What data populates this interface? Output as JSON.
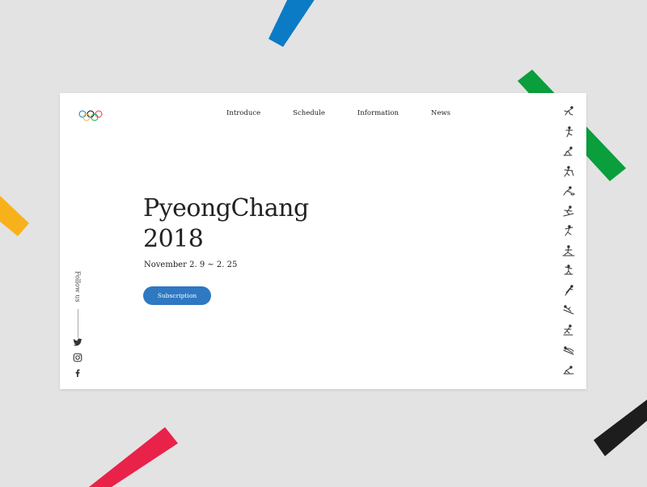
{
  "decorations": [
    {
      "name": "blue-stripe",
      "color": "#0b7bc6"
    },
    {
      "name": "green-stripe",
      "color": "#0a9e3d"
    },
    {
      "name": "yellow-stripe",
      "color": "#f7b21b"
    },
    {
      "name": "red-stripe",
      "color": "#e9224a"
    },
    {
      "name": "black-stripe",
      "color": "#1d1d1d"
    }
  ],
  "logo": {
    "icon": "olympic-rings-icon",
    "colors": [
      "#0081c8",
      "#fcb131",
      "#000000",
      "#00a651",
      "#ee334e"
    ]
  },
  "nav": {
    "items": [
      "Introduce",
      "Schedule",
      "Information",
      "News"
    ]
  },
  "hero": {
    "title_line1": "PyeongChang",
    "title_line2": "2018",
    "date": "November 2. 9 ~ 2. 25",
    "cta_label": "Subscription",
    "cta_color": "#2f78c2"
  },
  "follow": {
    "label": "Follow us"
  },
  "social": [
    {
      "icon": "twitter-icon"
    },
    {
      "icon": "instagram-icon"
    },
    {
      "icon": "facebook-icon"
    }
  ],
  "sports": [
    "speed-skating-icon",
    "figure-skating-icon",
    "short-track-icon",
    "ice-hockey-icon",
    "curling-icon",
    "alpine-skiing-icon",
    "biathlon-icon",
    "cross-country-icon",
    "freestyle-icon",
    "ski-jumping-icon",
    "snowboard-icon",
    "bobsleigh-icon",
    "luge-icon",
    "skeleton-icon"
  ]
}
